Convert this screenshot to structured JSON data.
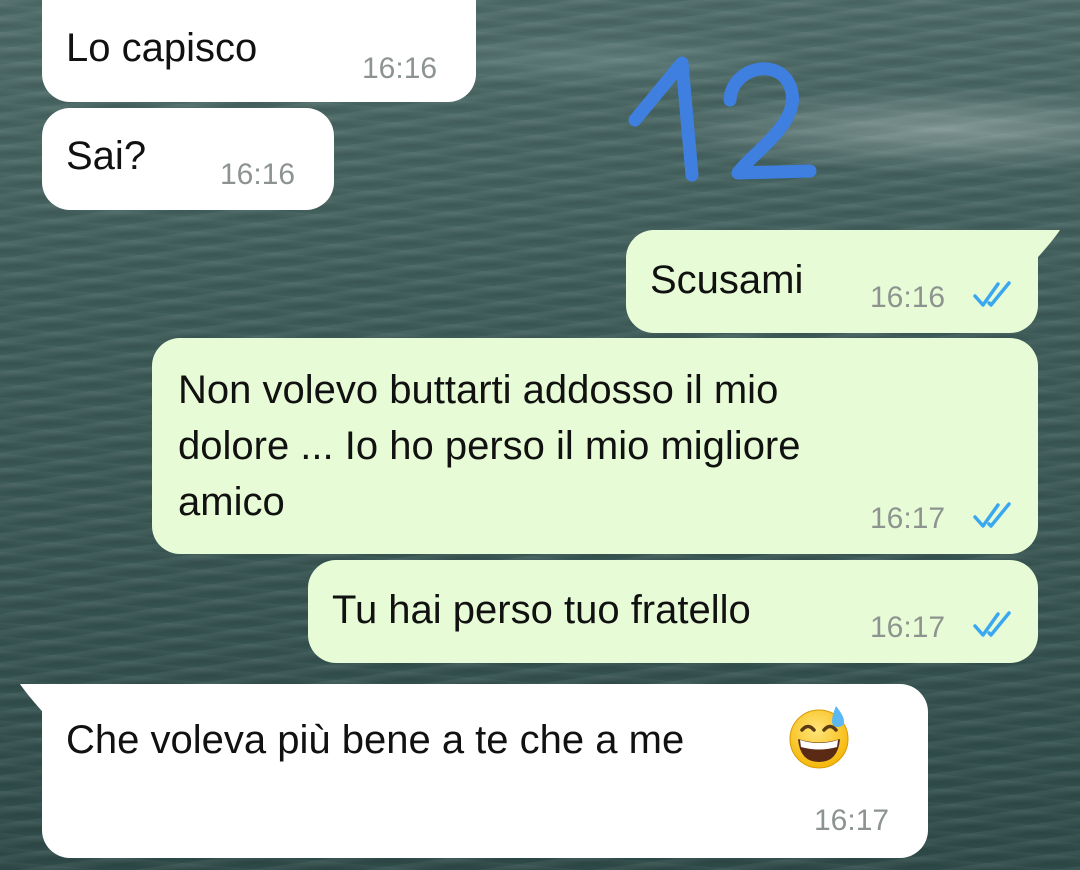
{
  "annotation": {
    "number": "12",
    "color": "#3f7fe0"
  },
  "colors": {
    "incoming": "#ffffff",
    "outgoing": "#e7fcd6",
    "timestamp": "#8d9490",
    "read_ticks": "#3aa8f0"
  },
  "messages": [
    {
      "direction": "incoming",
      "text": "Lo capisco",
      "time": "16:16"
    },
    {
      "direction": "incoming",
      "text": "Sai?",
      "time": "16:16"
    },
    {
      "direction": "outgoing",
      "text": "Scusami",
      "time": "16:16",
      "status_icon": "double-check-read-icon"
    },
    {
      "direction": "outgoing",
      "text_lines": [
        "Non volevo buttarti addosso il mio",
        "dolore ... Io ho perso il mio migliore",
        "amico"
      ],
      "time": "16:17",
      "status_icon": "double-check-read-icon"
    },
    {
      "direction": "outgoing",
      "text": "Tu hai perso tuo fratello",
      "time": "16:17",
      "status_icon": "double-check-read-icon"
    },
    {
      "direction": "incoming",
      "text": "Che voleva più bene a te che a me",
      "emoji": "grinning-face-with-sweat-emoji",
      "time": "16:17"
    }
  ]
}
